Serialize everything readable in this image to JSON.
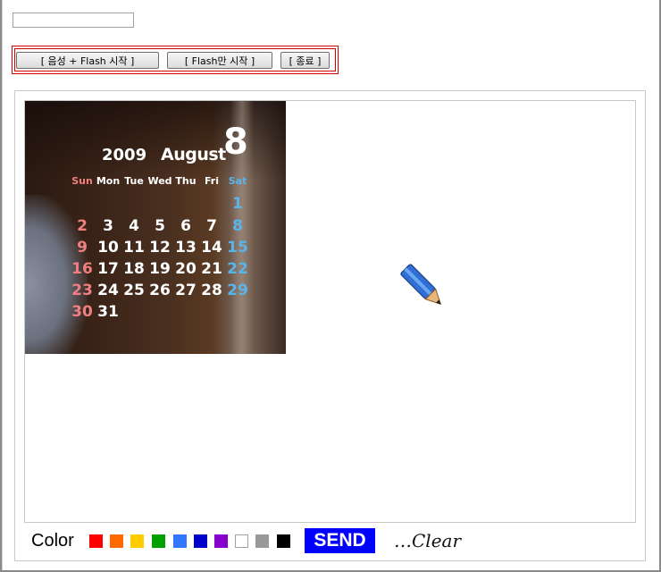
{
  "controls": {
    "top_input_value": "",
    "buttons": [
      "[ 음성 + Flash 시작 ]",
      "[ Flash만 시작 ]",
      "[ 종료 ]"
    ]
  },
  "calendar": {
    "year": "2009",
    "month": "August",
    "month_number": "8",
    "weekdays": [
      "Sun",
      "Mon",
      "Tue",
      "Wed",
      "Thu",
      "Fri",
      "Sat"
    ],
    "weeks": [
      [
        "",
        "",
        "",
        "",
        "",
        "",
        "1"
      ],
      [
        "2",
        "3",
        "4",
        "5",
        "6",
        "7",
        "8"
      ],
      [
        "9",
        "10",
        "11",
        "12",
        "13",
        "14",
        "15"
      ],
      [
        "16",
        "17",
        "18",
        "19",
        "20",
        "21",
        "22"
      ],
      [
        "23",
        "24",
        "25",
        "26",
        "27",
        "28",
        "29"
      ],
      [
        "30",
        "31",
        "",
        "",
        "",
        "",
        ""
      ]
    ]
  },
  "toolbar": {
    "color_label": "Color",
    "swatches": [
      "#ff0000",
      "#ff6a00",
      "#ffcc00",
      "#00a000",
      "#3377ff",
      "#0000cc",
      "#8800cc",
      "#ffffff",
      "#999999",
      "#000000"
    ],
    "send_label": "SEND",
    "clear_label": "…Clear"
  },
  "icons": {
    "cursor": "pencil-icon"
  }
}
